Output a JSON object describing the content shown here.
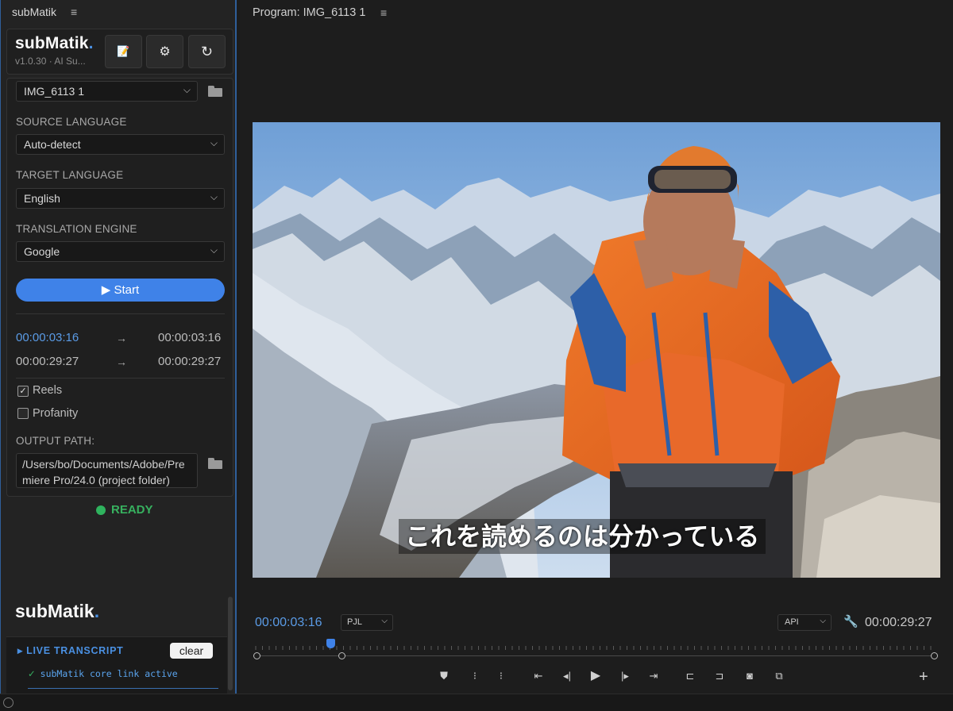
{
  "left_panel": {
    "tab_title": "subMatik",
    "menu_glyph": "≡",
    "brand": "subMatik",
    "brand_dot": ".",
    "version": "v1.0.30 · AI Su...",
    "header_buttons": [
      {
        "icon": "notepad-icon",
        "glyph": "📝"
      },
      {
        "icon": "gear-icon",
        "glyph": "⚙"
      },
      {
        "icon": "refresh-icon",
        "glyph": "↻"
      }
    ],
    "sequence": {
      "value": "IMG_6113 1"
    },
    "source_language": {
      "label": "SOURCE LANGUAGE",
      "value": "Auto-detect"
    },
    "target_language": {
      "label": "TARGET LANGUAGE",
      "value": "English"
    },
    "translation_engine": {
      "label": "TRANSLATION ENGINE",
      "value": "Google"
    },
    "start_button": "▶ Start",
    "in_point": {
      "start": "00:00:03:16",
      "end": "00:00:03:16"
    },
    "out_point": {
      "start": "00:00:29:27",
      "end": "00:00:29:27"
    },
    "arrow": "→",
    "reels": {
      "label": "Reels",
      "checked": true,
      "mark": "✓"
    },
    "profanity": {
      "label": "Profanity",
      "checked": false
    },
    "output_path": {
      "label": "OUTPUT PATH:",
      "value": "/Users/bo/Documents/Adobe/Premiere Pro/24.0 (project folder)"
    },
    "status": "READY",
    "brand_footer": "subMatik",
    "live_transcript": {
      "title": "▸ LIVE TRANSCRIPT",
      "clear_label": "clear",
      "log": "subMatik core link active",
      "log_check": "✓"
    }
  },
  "program_monitor": {
    "title": "Program: IMG_6113 1",
    "menu_glyph": "≡",
    "subtitle": "これを読めるのは分かっている",
    "timecode_current": "00:00:03:16",
    "fit_value": "PJL",
    "api_value": "API",
    "timecode_duration": "00:00:29:27",
    "playhead_fraction": 0.113,
    "add_glyph": "+",
    "transport_controls": [
      {
        "icon": "marker-icon",
        "glyph": "⛊"
      },
      {
        "icon": "mark-in-icon",
        "glyph": "⁝"
      },
      {
        "icon": "mark-out-icon",
        "glyph": "⁝"
      },
      {
        "icon": "go-to-in-icon",
        "glyph": "⇤"
      },
      {
        "icon": "step-back-icon",
        "glyph": "◂|"
      },
      {
        "icon": "play-icon",
        "glyph": "▶"
      },
      {
        "icon": "step-forward-icon",
        "glyph": "|▸"
      },
      {
        "icon": "go-to-out-icon",
        "glyph": "⇥"
      },
      {
        "icon": "lift-icon",
        "glyph": "⊏"
      },
      {
        "icon": "extract-icon",
        "glyph": "⊐"
      },
      {
        "icon": "export-frame-icon",
        "glyph": "◙"
      },
      {
        "icon": "comparison-view-icon",
        "glyph": "⧉"
      }
    ]
  },
  "colors": {
    "accent": "#3f82e8",
    "ready": "#2fb35e",
    "timecode_blue": "#5a9be6"
  }
}
